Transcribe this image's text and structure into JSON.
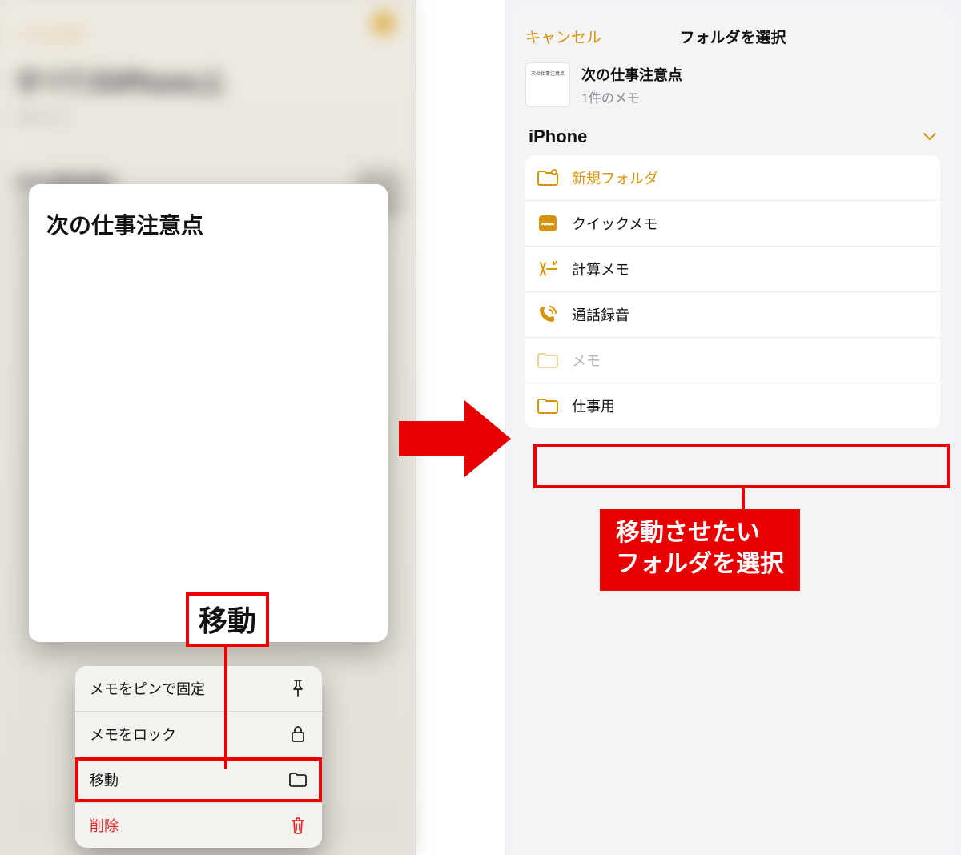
{
  "left": {
    "blurred": {
      "back": "< フォルダ",
      "title": "すべてのiPhone上",
      "sub": "1件のメモ",
      "list_title": "次の仕事注意点",
      "list_time": "15:14  追加テキストなし"
    },
    "preview_title": "次の仕事注意点",
    "move_label": "移動",
    "menu": {
      "pin": "メモをピンで固定",
      "lock": "メモをロック",
      "move": "移動",
      "delete": "削除"
    }
  },
  "right": {
    "cancel": "キャンセル",
    "header_title": "フォルダを選択",
    "note": {
      "title": "次の仕事注意点",
      "count": "1件のメモ"
    },
    "section": "iPhone",
    "folders": {
      "new": "新規フォルダ",
      "quick": "クイックメモ",
      "calc": "計算メモ",
      "call": "通話録音",
      "memo": "メモ",
      "work": "仕事用"
    },
    "callout": "移動させたい\nフォルダを選択"
  }
}
